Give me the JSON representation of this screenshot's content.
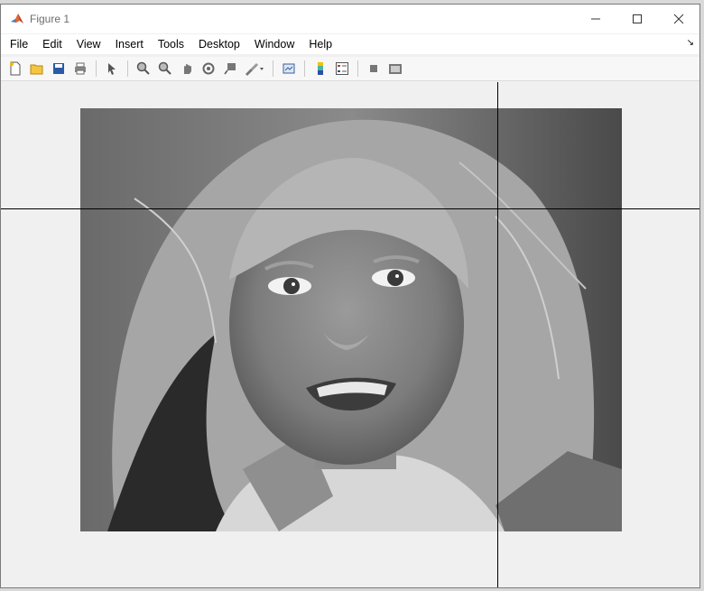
{
  "window": {
    "title": "Figure 1"
  },
  "menu": {
    "items": [
      "File",
      "Edit",
      "View",
      "Insert",
      "Tools",
      "Desktop",
      "Window",
      "Help"
    ]
  },
  "toolbar": {
    "icons": [
      "new-figure-icon",
      "open-file-icon",
      "save-icon",
      "print-icon",
      "edit-plot-arrow-icon",
      "zoom-in-icon",
      "zoom-out-icon",
      "pan-icon",
      "rotate-3d-icon",
      "data-cursor-icon",
      "brush-icon",
      "link-plot-icon",
      "insert-colorbar-icon",
      "insert-legend-icon",
      "hide-plot-tools-icon",
      "show-plot-tools-icon"
    ]
  },
  "colors": {
    "window_bg": "#f0f0f0",
    "titlebar_bg": "#ffffff",
    "crosshair": "#000000"
  }
}
